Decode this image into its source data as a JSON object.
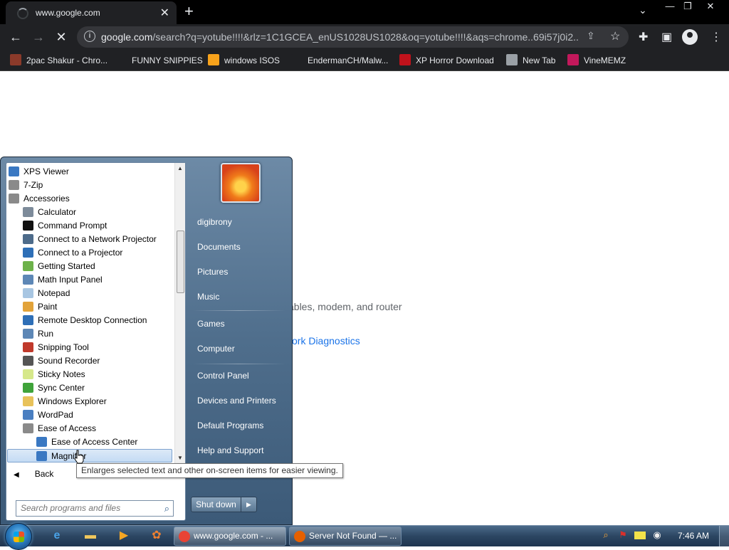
{
  "browser": {
    "tab_title": "www.google.com",
    "url_domain": "google.com",
    "url_rest": "/search?q=yotube!!!!&rlz=1C1GCEA_enUS1028US1028&oq=yotube!!!!&aqs=chrome..69i57j0i2...",
    "bookmarks": [
      {
        "label": "2pac Shakur - Chro...",
        "icon": "2pac-favicon",
        "color": "#8b3a2a"
      },
      {
        "label": "FUNNY SNIPPIES",
        "icon": "H-favicon",
        "color": "#202124"
      },
      {
        "label": "windows ISOS",
        "icon": "PH-favicon",
        "color": "#f7a21b"
      },
      {
        "label": "EndermanCH/Malw...",
        "icon": "YP-favicon",
        "color": "#202124"
      },
      {
        "label": "XP Horror Download",
        "icon": "X-favicon",
        "color": "#c0121b"
      },
      {
        "label": "New Tab",
        "icon": "globe-favicon",
        "color": "#9aa0a6"
      },
      {
        "label": "VineMEMZ",
        "icon": "R-favicon",
        "color": "#c2185b"
      }
    ]
  },
  "page": {
    "text_fragment": "ables, modem, and router",
    "link_fragment": "ork Diagnostics"
  },
  "startmenu": {
    "programs": [
      {
        "label": "XPS Viewer",
        "icon": "xps-viewer-icon",
        "indent": 0,
        "color": "#3a78c2"
      },
      {
        "label": "7-Zip",
        "icon": "folder-icon",
        "indent": 0,
        "color": "#8a8a8a"
      },
      {
        "label": "Accessories",
        "icon": "folder-icon",
        "indent": 0,
        "color": "#8a8a8a"
      },
      {
        "label": "Calculator",
        "icon": "calculator-icon",
        "indent": 1,
        "color": "#7d8b9a"
      },
      {
        "label": "Command Prompt",
        "icon": "command-prompt-icon",
        "indent": 1,
        "color": "#111111"
      },
      {
        "label": "Connect to a Network Projector",
        "icon": "network-projector-icon",
        "indent": 1,
        "color": "#4d6b8a"
      },
      {
        "label": "Connect to a Projector",
        "icon": "projector-icon",
        "indent": 1,
        "color": "#2e6fb7"
      },
      {
        "label": "Getting Started",
        "icon": "getting-started-icon",
        "indent": 1,
        "color": "#6db24a"
      },
      {
        "label": "Math Input Panel",
        "icon": "math-input-icon",
        "indent": 1,
        "color": "#5d87b6"
      },
      {
        "label": "Notepad",
        "icon": "notepad-icon",
        "indent": 1,
        "color": "#a8c6e2"
      },
      {
        "label": "Paint",
        "icon": "paint-icon",
        "indent": 1,
        "color": "#e2a33a"
      },
      {
        "label": "Remote Desktop Connection",
        "icon": "remote-desktop-icon",
        "indent": 1,
        "color": "#2e6fb7"
      },
      {
        "label": "Run",
        "icon": "run-icon",
        "indent": 1,
        "color": "#5d87b6"
      },
      {
        "label": "Snipping Tool",
        "icon": "snipping-tool-icon",
        "indent": 1,
        "color": "#c0392b"
      },
      {
        "label": "Sound Recorder",
        "icon": "microphone-icon",
        "indent": 1,
        "color": "#555555"
      },
      {
        "label": "Sticky Notes",
        "icon": "sticky-notes-icon",
        "indent": 1,
        "color": "#d6e88a"
      },
      {
        "label": "Sync Center",
        "icon": "sync-center-icon",
        "indent": 1,
        "color": "#3fa33a"
      },
      {
        "label": "Windows Explorer",
        "icon": "folder-icon",
        "indent": 1,
        "color": "#e8c25a"
      },
      {
        "label": "WordPad",
        "icon": "wordpad-icon",
        "indent": 1,
        "color": "#4a7fc1"
      },
      {
        "label": "Ease of Access",
        "icon": "folder-icon",
        "indent": 1,
        "color": "#8a8a8a"
      },
      {
        "label": "Ease of Access Center",
        "icon": "ease-of-access-icon",
        "indent": 2,
        "color": "#3a78c2"
      },
      {
        "label": "Magnifier",
        "icon": "magnifier-icon",
        "indent": 2,
        "color": "#3a78c2",
        "selected": true
      }
    ],
    "back_label": "Back",
    "search_placeholder": "Search programs and files",
    "right_items": [
      "digibrony",
      "Documents",
      "Pictures",
      "Music",
      "Games",
      "Computer",
      "Control Panel",
      "Devices and Printers",
      "Default Programs",
      "Help and Support"
    ],
    "shutdown_label": "Shut down",
    "tooltip": "Enlarges selected text and other on-screen items for easier viewing."
  },
  "taskbar": {
    "tasks": [
      {
        "label": "www.google.com - ...",
        "icon": "chrome-icon",
        "color": "#e94335"
      },
      {
        "label": "Server Not Found — ...",
        "icon": "firefox-icon",
        "color": "#e66000"
      }
    ],
    "clock": "7:46 AM"
  }
}
